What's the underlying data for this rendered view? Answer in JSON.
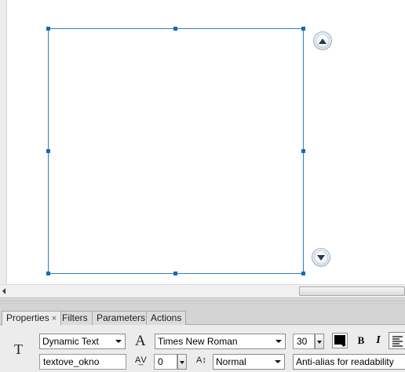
{
  "stage": {
    "scroll_up_icon": "triangle-up-icon",
    "scroll_down_icon": "triangle-down-icon"
  },
  "panel": {
    "tabs": [
      {
        "label": "Properties",
        "close": "×",
        "active": true
      },
      {
        "label": "Filters",
        "active": false
      },
      {
        "label": "Parameters",
        "active": false
      },
      {
        "label": "Actions",
        "active": false
      }
    ],
    "text_tool_glyph": "T",
    "text_type": "Dynamic Text",
    "font_icon_glyph": "A",
    "font_family": "Times New Roman",
    "font_size": "30",
    "text_color": "#000000",
    "bold_label": "B",
    "italic_label": "I",
    "instance_name": "textove_okno",
    "letter_spacing_icon_glyph": "A͢V",
    "letter_spacing": "0",
    "char_position_icon_glyph": "A↕",
    "char_position": "Normal",
    "anti_alias": "Anti-alias for readability"
  },
  "colors": {
    "selection": "#2c7fd0",
    "panel_bg": "#ececec"
  }
}
